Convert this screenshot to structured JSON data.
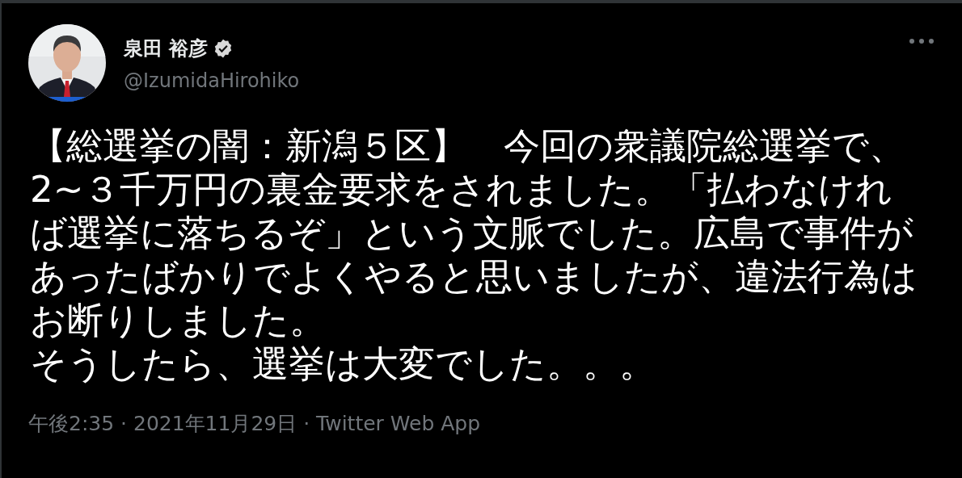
{
  "author": {
    "name": "泉田 裕彦",
    "verified": true,
    "handle": "@IzumidaHirohiko"
  },
  "paragraphs": [
    "【総選挙の闇：新潟５区】　今回の衆議院総選挙で、2~３千万円の裏金要求をされました。「払わなければ選挙に落ちるぞ」という文脈でした。広島で事件があったばかりでよくやると思いましたが、違法行為はお断りしました。",
    "そうしたら、選挙は大変でした。。。"
  ],
  "meta": "午後2:35 · 2021年11月29日 · Twitter Web App"
}
